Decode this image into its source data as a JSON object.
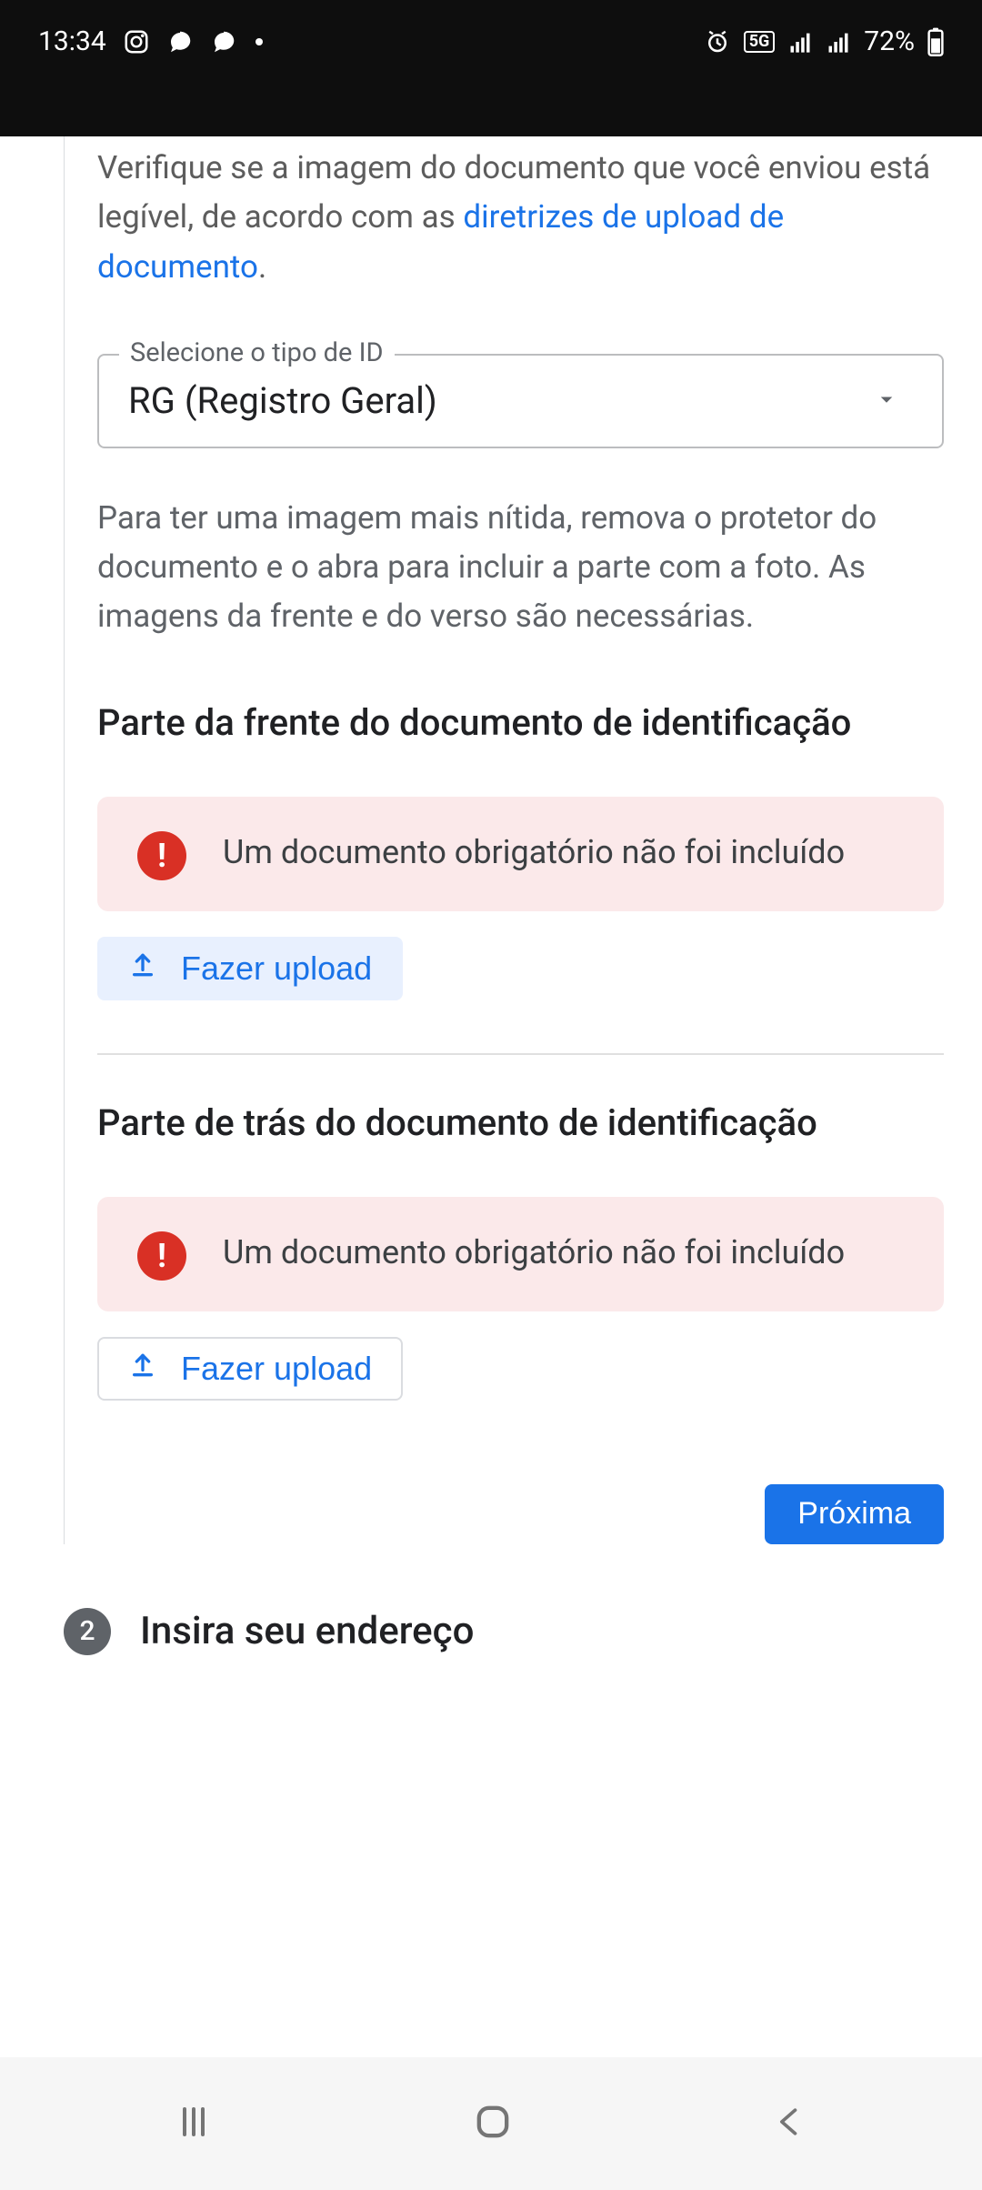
{
  "status": {
    "time": "13:34",
    "battery": "72%",
    "net_badge": "5G"
  },
  "intro": {
    "pre": "Verifique se a imagem do documento que você enviou está legível, de acordo com as ",
    "link": "diretrizes de upload de documento",
    "post": "."
  },
  "select": {
    "label": "Selecione o tipo de ID",
    "value": "RG (Registro Geral)"
  },
  "helper": "Para ter uma imagem mais nítida, remova o protetor do documento e o abra para incluir a parte com a foto. As imagens da frente e do verso são necessárias.",
  "front": {
    "title": "Parte da frente do documento de identificação",
    "alert": "Um documento obrigatório não foi incluído",
    "upload": "Fazer upload"
  },
  "back": {
    "title": "Parte de trás do documento de identificação",
    "alert": "Um documento obrigatório não foi incluído",
    "upload": "Fazer upload"
  },
  "next": "Próxima",
  "step2": {
    "number": "2",
    "title": "Insira seu endereço"
  }
}
